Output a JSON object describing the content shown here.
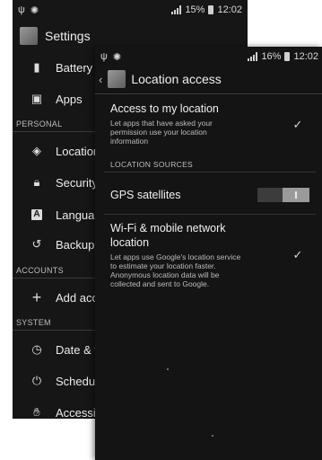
{
  "settings_screen": {
    "status": {
      "battery_text": "15%",
      "time": "12:02"
    },
    "title": "Settings",
    "items": [
      {
        "label": "Battery",
        "icon": "battery-icon"
      },
      {
        "label": "Apps",
        "icon": "apps-icon"
      },
      {
        "label": "Location",
        "icon": "location-icon"
      },
      {
        "label": "Security",
        "icon": "lock-icon"
      },
      {
        "label": "Languag",
        "icon": "language-icon"
      },
      {
        "label": "Backup &",
        "icon": "backup-icon"
      },
      {
        "label": "Add acco",
        "icon": "plus-icon"
      },
      {
        "label": "Date & ti",
        "icon": "clock-icon"
      },
      {
        "label": "Schedule",
        "icon": "power-icon"
      },
      {
        "label": "Accessib",
        "icon": "hand-icon"
      }
    ],
    "sections": {
      "personal": "PERSONAL",
      "accounts": "ACCOUNTS",
      "system": "SYSTEM"
    }
  },
  "location_screen": {
    "status": {
      "battery_text": "16%",
      "time": "12:02"
    },
    "title": "Location access",
    "access": {
      "title": "Access to my location",
      "summary": [
        "Let apps that have asked your",
        "permission use your location",
        "information"
      ],
      "checked": true
    },
    "sources_header": "LOCATION SOURCES",
    "gps": {
      "title": "GPS satellites",
      "toggle_label": "I",
      "enabled": true
    },
    "wifi": {
      "title": [
        "Wi-Fi & mobile network",
        "location"
      ],
      "summary": [
        "Let apps use Google's location service",
        "to estimate your location faster.",
        "Anonymous location data will be",
        "collected and sent to Google."
      ],
      "checked": true
    }
  }
}
